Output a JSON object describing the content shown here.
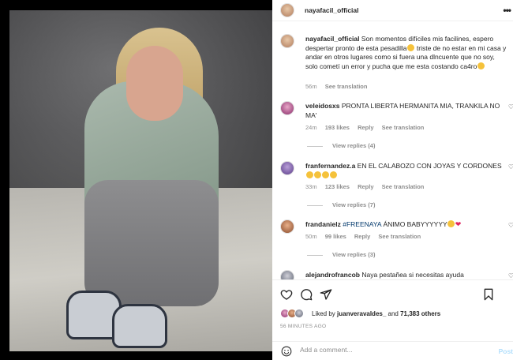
{
  "post": {
    "username": "nayafacil_official",
    "more_icon": "more-horizontal-icon"
  },
  "caption": {
    "username": "nayafacil_official",
    "text_1": "Son momentos difíciles mis facilines, espero despertar pronto de esta pesadilla",
    "text_2": " triste de no estar en mi casa y andar en otros lugares como si fuera una dlncuente que no soy, solo cometí un error y pucha que me esta costando ca4ro",
    "time": "56m",
    "translation": "See translation"
  },
  "comments": [
    {
      "username": "veleidosxs",
      "text": "PRONTA LIBERTA HERMANITA MIA, TRANKILA NO MA'",
      "time": "24m",
      "likes": "193 likes",
      "reply": "Reply",
      "translation": "See translation",
      "replies": "View replies (4)"
    },
    {
      "username": "franfernandez.a",
      "text": "EN EL CALABOZO CON JOYAS Y CORDONES",
      "time": "33m",
      "likes": "123 likes",
      "reply": "Reply",
      "translation": "See translation",
      "replies": "View replies (7)"
    },
    {
      "username": "frandanielz",
      "hashtag": "#FREENAYA",
      "text": " ÁNIMO BABYYYYYY",
      "time": "50m",
      "likes": "99 likes",
      "reply": "Reply",
      "translation": "See translation",
      "replies": "View replies (3)"
    },
    {
      "username": "alejandrofrancob",
      "text": "Naya pestañea si necesitas ayuda"
    }
  ],
  "actions": {
    "liked_by_prefix": "Liked by ",
    "liked_by_user": "juanveravaldes_",
    "liked_by_and": " and ",
    "liked_by_others": "71,383 others",
    "time_ago": "56 MINUTES AGO"
  },
  "add_comment": {
    "placeholder": "Add a comment...",
    "post_label": "Post"
  },
  "colors": {
    "link_blue": "#00376b",
    "post_button_disabled": "#b2dffc",
    "muted": "#8e8e8e",
    "heart_red": "#e0245e"
  }
}
